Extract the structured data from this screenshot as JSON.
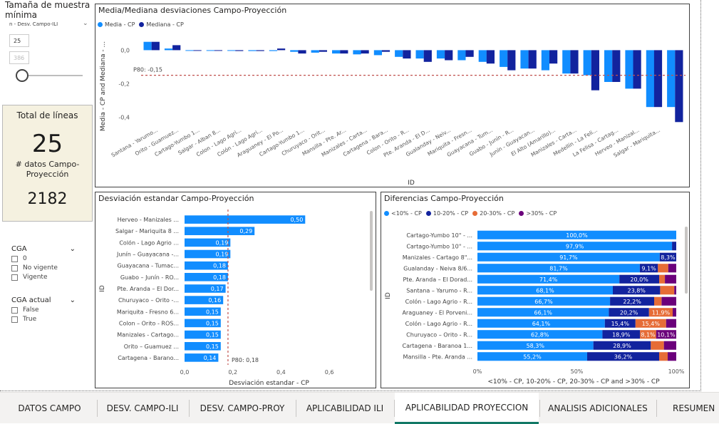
{
  "slicer": {
    "title": "Tamaña de muestra mínima",
    "dropdown_label": "n - Desv. Campo-ILI",
    "min_value": "25",
    "max_value": "386"
  },
  "card": {
    "title": "Total de líneas",
    "lines_value": "25",
    "datos_label": "# datos Campo-Proyección",
    "datos_value": "2182"
  },
  "cga": {
    "title": "CGA",
    "options": [
      "0",
      "No vigente",
      "Vigente"
    ]
  },
  "cga_actual": {
    "title": "CGA actual",
    "options": [
      "False",
      "True"
    ]
  },
  "colors": {
    "media": "#118DFF",
    "mediana": "#12239E",
    "lt10": "#118DFF",
    "b10_20": "#12239E",
    "b20_30": "#E66C37",
    "gt30": "#6B007B",
    "ref_line": "#C0504D"
  },
  "tabs": [
    "DATOS CAMPO",
    "DESV. CAMPO-ILI",
    "DESV. CAMPO-PROY",
    "APLICABILIDAD ILI",
    "APLICABILIDAD PROYECCION",
    "ANALISIS ADICIONALES",
    "RESUMEN"
  ],
  "active_tab": "APLICABILIDAD PROYECCION",
  "chart_data": [
    {
      "type": "bar",
      "title": "Media/Mediana desviaciones Campo-Proyección",
      "xlabel": "ID",
      "ylabel": "Media - CP and Mediana - ...",
      "ylim": [
        -0.45,
        0.07
      ],
      "yticks": [
        "0,0",
        "-0,2",
        "-0,4"
      ],
      "ytick_values": [
        0,
        -0.2,
        -0.4
      ],
      "ref_line": {
        "value": -0.15,
        "label": "P80: -0,15"
      },
      "categories": [
        "Santana - Yarumo...",
        "Orito - Guamuez...",
        "Cartago-Yumbo 1...",
        "Salgar - Alban 8...",
        "Colon - Lago Agri...",
        "Colón - Lago Agri...",
        "Araguaney - El Po...",
        "Cartago-Yumbo 1...",
        "Churuyaco - Orit...",
        "Mansilla - Pte. Ar...",
        "Manizales - Carta...",
        "Cartagena - Bara...",
        "Colon - Orito - R...",
        "Pte. Aranda - El D...",
        "Gualanday - Neiv...",
        "Mariquita - Fresn...",
        "Guayacana - Tum...",
        "Guabo - Junín - R...",
        "Junín - Guayacan...",
        "El Alto (Amarillo)...",
        "Manizales - Carta...",
        "Medellín - La Feli...",
        "La Felisa - Cartag...",
        "Herveo - Manizal...",
        "Salgar - Mariquita..."
      ],
      "x_labeled_indices": [
        0,
        1,
        2,
        3,
        4,
        5,
        6,
        7,
        8,
        9,
        10,
        11,
        12,
        13,
        14,
        15,
        16,
        17,
        18,
        19,
        20,
        21,
        22,
        23,
        24
      ],
      "series": [
        {
          "name": "Media - CP",
          "values": [
            0.05,
            0.01,
            0.0,
            0.0,
            0.0,
            -0.005,
            -0.005,
            -0.01,
            -0.015,
            -0.02,
            -0.025,
            -0.03,
            -0.04,
            -0.05,
            -0.05,
            -0.06,
            -0.07,
            -0.1,
            -0.11,
            -0.12,
            -0.14,
            -0.15,
            -0.19,
            -0.23,
            -0.34,
            -0.34
          ]
        },
        {
          "name": "Mediana - CP",
          "values": [
            0.05,
            0.03,
            0.0,
            0.0,
            -0.005,
            -0.005,
            0.01,
            -0.02,
            -0.01,
            -0.02,
            -0.02,
            -0.01,
            -0.05,
            -0.07,
            -0.06,
            -0.04,
            -0.08,
            -0.12,
            -0.11,
            -0.08,
            -0.14,
            -0.24,
            -0.19,
            -0.23,
            -0.34,
            -0.43
          ]
        }
      ],
      "legend": "top-left"
    },
    {
      "type": "bar",
      "orientation": "horizontal",
      "title": "Desviación estandar Campo-Proyección",
      "xlabel": "Desviación estandar - CP",
      "ylabel": "ID",
      "xlim": [
        0,
        0.7
      ],
      "xticks": [
        "0,0",
        "0,2",
        "0,4",
        "0,6"
      ],
      "xtick_values": [
        0,
        0.2,
        0.4,
        0.6
      ],
      "ref_line": {
        "value": 0.18,
        "label": "P80: 0,18"
      },
      "categories": [
        "Herveo - Manizales ...",
        "Salgar - Mariquita 8 ...",
        "Colón - Lago Agrio ...",
        "Junín – Guayacana -...",
        "Guayacana - Tumac...",
        "Guabo – Junín - RO...",
        "Pte. Aranda – El Dor...",
        "Churuyaco – Orito -...",
        "Mariquita - Fresno 6...",
        "Colon – Orito - ROS...",
        "Manizales - Cartago...",
        "Orito – Guamuez ...",
        "Cartagena - Barano..."
      ],
      "values": [
        0.5,
        0.29,
        0.19,
        0.19,
        0.18,
        0.18,
        0.17,
        0.16,
        0.15,
        0.15,
        0.15,
        0.15,
        0.14
      ],
      "labels": [
        "0,50",
        "0,29",
        "0,19",
        "0,19",
        "0,18",
        "0,18",
        "0,17",
        "0,16",
        "0,15",
        "0,15",
        "0,15",
        "0,15",
        "0,14"
      ]
    },
    {
      "type": "bar",
      "orientation": "horizontal",
      "stacked": "100%",
      "title": "Diferencias Campo-Proyección",
      "xlabel": "<10% - CP, 10-20% - CP, 20-30% - CP and >30% - CP",
      "ylabel": "ID",
      "xticks": [
        "0%",
        "50%",
        "100%"
      ],
      "xtick_values": [
        0,
        0.5,
        1
      ],
      "legend": "top-left",
      "categories": [
        "Cartago-Yumbo 10\" - ...",
        "Cartago-Yumbo 10\" - ...",
        "Manizales - Cartago 8\"...",
        "Gualanday - Neiva 8/6...",
        "Pte. Aranda – El Dorad...",
        "Santana – Yarumo - R...",
        "Colón - Lago Agrio - R...",
        "Araguaney - El Porveni...",
        "Colón - Lago Agrio - R...",
        "Churuyaco – Orito - R...",
        "Cartagena - Baranoa 1...",
        "Mansilla - Pte. Aranda ..."
      ],
      "series": [
        {
          "name": "<10% - CP",
          "values": [
            100.0,
            97.9,
            91.7,
            81.7,
            71.4,
            68.1,
            66.7,
            66.1,
            64.1,
            62.8,
            58.3,
            55.2
          ],
          "labels": [
            "100,0%",
            "97,9%",
            "91,7%",
            "81,7%",
            "71,4%",
            "68,1%",
            "66,7%",
            "66,1%",
            "64,1%",
            "62,8%",
            "58,3%",
            "55,2%"
          ]
        },
        {
          "name": "10-20% - CP",
          "values": [
            0,
            2.1,
            8.3,
            9.1,
            20.0,
            23.8,
            22.2,
            20.2,
            15.4,
            18.9,
            28.9,
            36.2
          ],
          "labels": [
            "",
            "",
            "8,3%",
            "9,1%",
            "20,0%",
            "23,8%",
            "22,2%",
            "20,2%",
            "15,4%",
            "18,9%",
            "28,9%",
            "36,2%"
          ]
        },
        {
          "name": "20-30% - CP",
          "values": [
            0,
            0,
            0,
            5.2,
            2.9,
            7.1,
            3.7,
            11.9,
            15.4,
            8.1,
            6.6,
            4.3
          ],
          "labels": [
            "",
            "",
            "",
            "",
            "",
            "",
            "",
            "11,9%",
            "15,4%",
            "8,1%",
            "",
            ""
          ]
        },
        {
          "name": ">30% - CP",
          "values": [
            0,
            0,
            0,
            4.0,
            5.7,
            1.0,
            7.4,
            1.8,
            5.1,
            10.1,
            6.2,
            4.3
          ],
          "labels": [
            "",
            "",
            "",
            "",
            "",
            "",
            "",
            "",
            "",
            "10,1%",
            "",
            ""
          ]
        }
      ]
    }
  ]
}
